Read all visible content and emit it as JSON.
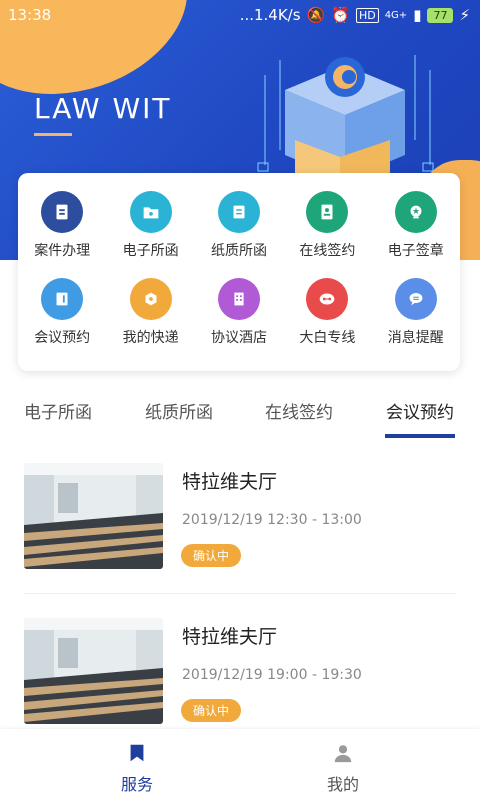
{
  "status_bar": {
    "time": "13:38",
    "network": "...1.4K/s",
    "battery": "77",
    "hd": "HD",
    "signal": "4G+"
  },
  "header": {
    "title": "LAW WIT"
  },
  "services": [
    {
      "label": "案件办理",
      "icon": "case-icon",
      "color": "#2d4e9e"
    },
    {
      "label": "电子所函",
      "icon": "folder-icon",
      "color": "#2bb3d6"
    },
    {
      "label": "纸质所函",
      "icon": "document-icon",
      "color": "#2bb3d6"
    },
    {
      "label": "在线签约",
      "icon": "contract-icon",
      "color": "#1fa57a"
    },
    {
      "label": "电子签章",
      "icon": "seal-icon",
      "color": "#1fa57a"
    },
    {
      "label": "会议预约",
      "icon": "meeting-icon",
      "color": "#3f9be3"
    },
    {
      "label": "我的快递",
      "icon": "package-icon",
      "color": "#f2a93b"
    },
    {
      "label": "协议酒店",
      "icon": "hotel-icon",
      "color": "#b05ad6"
    },
    {
      "label": "大白专线",
      "icon": "robot-icon",
      "color": "#e94b4b"
    },
    {
      "label": "消息提醒",
      "icon": "message-icon",
      "color": "#5b8ee8"
    }
  ],
  "tabs": [
    "电子所函",
    "纸质所函",
    "在线签约",
    "会议预约"
  ],
  "active_tab": "会议预约",
  "bookings": [
    {
      "title": "特拉维夫厅",
      "time": "2019/12/19  12:30 - 13:00",
      "status": "确认中"
    },
    {
      "title": "特拉维夫厅",
      "time": "2019/12/19  19:00 - 19:30",
      "status": "确认中"
    }
  ],
  "bottom_nav": [
    {
      "label": "服务",
      "icon": "bookmark-icon",
      "active": true
    },
    {
      "label": "我的",
      "icon": "person-icon",
      "active": false
    }
  ],
  "colors": {
    "primary": "#2b5fd7",
    "accent": "#f2a93b",
    "tab_indicator": "#1f3f9f"
  }
}
